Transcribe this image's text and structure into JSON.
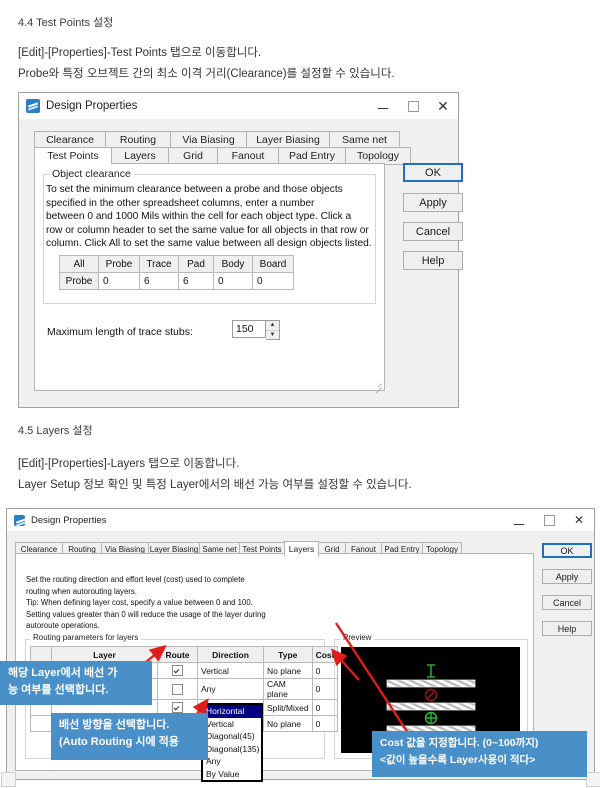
{
  "doc": {
    "section1_heading": "4.4 Test Points 설정",
    "section1_line1": "[Edit]-[Properties]-Test Points 탭으로 이동합니다.",
    "section1_line2": "Probe와 특정 오브젝트 간의 최소 이격 거리(Clearance)를 설정할 수 있습니다.",
    "section2_heading": "4.5 Layers 설정",
    "section2_line1": "[Edit]-[Properties]-Layers 탭으로 이동합니다.",
    "section2_line2": "Layer Setup 정보 확인 및 특정 Layer에서의 배선 가능 여부를 설정할 수 있습니다."
  },
  "dialog1": {
    "title": "Design Properties",
    "window_controls": {
      "minimize": "minimize-icon",
      "maximize": "maximize-icon",
      "close": "✕"
    },
    "tabs_row1": [
      "Clearance",
      "Routing",
      "Via Biasing",
      "Layer Biasing",
      "Same net"
    ],
    "tabs_row2": [
      "Test Points",
      "Layers",
      "Grid",
      "Fanout",
      "Pad Entry",
      "Topology"
    ],
    "selected_tab": "Test Points",
    "group_caption": "Object clearance",
    "group_text": "To set the minimum clearance between a probe and those objects\nspecified in the other spreadsheet columns, enter a number\nbetween 0 and 1000 Mils within the cell for each object type. Click a\nrow or column header to set the same value for all objects in that row or\ncolumn. Click All to set the same value between all design objects listed.",
    "table": {
      "headers": [
        "All",
        "Probe",
        "Trace",
        "Pad",
        "Body",
        "Board"
      ],
      "rows": [
        {
          "label": "Probe",
          "values": [
            "0",
            "6",
            "6",
            "0",
            "0"
          ]
        }
      ]
    },
    "stub_label": "Maximum length of trace stubs:",
    "stub_value": "150",
    "buttons": [
      "OK",
      "Apply",
      "Cancel",
      "Help"
    ]
  },
  "dialog2": {
    "title": "Design Properties",
    "tabs": [
      "Clearance",
      "Routing",
      "Via Biasing",
      "Layer Biasing",
      "Same net",
      "Test Points",
      "Layers",
      "Grid",
      "Fanout",
      "Pad Entry",
      "Topology"
    ],
    "selected_tab": "Layers",
    "description": "Set the routing direction and effort level (cost) used to complete\nrouting when autorouting layers.\nTip: When defining layer cost, specify a value between 0 and 100.\nSetting values greater than 0 will reduce the usage of the layer during\nautoroute operations.",
    "group_caption": "Routing parameters for layers",
    "table": {
      "headers": [
        "",
        "Layer",
        "Route",
        "Direction",
        "Type",
        "Cost"
      ],
      "rows": [
        {
          "num": "",
          "layer": "",
          "route": true,
          "direction": "Vertical",
          "type": "No plane",
          "cost": "0"
        },
        {
          "num": "",
          "layer": "",
          "route": false,
          "direction": "Any",
          "type": "CAM plane",
          "cost": "0"
        },
        {
          "num": "",
          "layer": "",
          "route": true,
          "direction": "Any",
          "type": "Split/Mixed",
          "cost": "0"
        },
        {
          "num": "",
          "layer": "",
          "route": true,
          "direction": "Horizontal",
          "type": "No plane",
          "cost": "0"
        }
      ]
    },
    "dropdown": {
      "options": [
        "Horizontal",
        "Vertical",
        "Diagonal(45)",
        "Diagonal(135)",
        "Any",
        "By Value"
      ],
      "selected": "Horizontal"
    },
    "preview_caption": "Preview",
    "buttons": [
      "OK",
      "Apply",
      "Cancel",
      "Help"
    ]
  },
  "annotations": [
    {
      "id": "note-route",
      "text": "해당 Layer에서 배선 가\n능 여부를 선택합니다."
    },
    {
      "id": "note-direction",
      "text": "배선 방향을 선택합니다.\n(Auto Routing 시에 적용"
    },
    {
      "id": "note-cost",
      "text": "Cost 값을 지정합니다. (0~100까지)\n<값이 높을수록 Layer사용이 적다>"
    }
  ],
  "colors": {
    "annotation_bg": "#4a90c8",
    "arrow": "#e21b1b",
    "accent_blue": "#1d6fc0",
    "dropdown_sel": "#000080"
  }
}
